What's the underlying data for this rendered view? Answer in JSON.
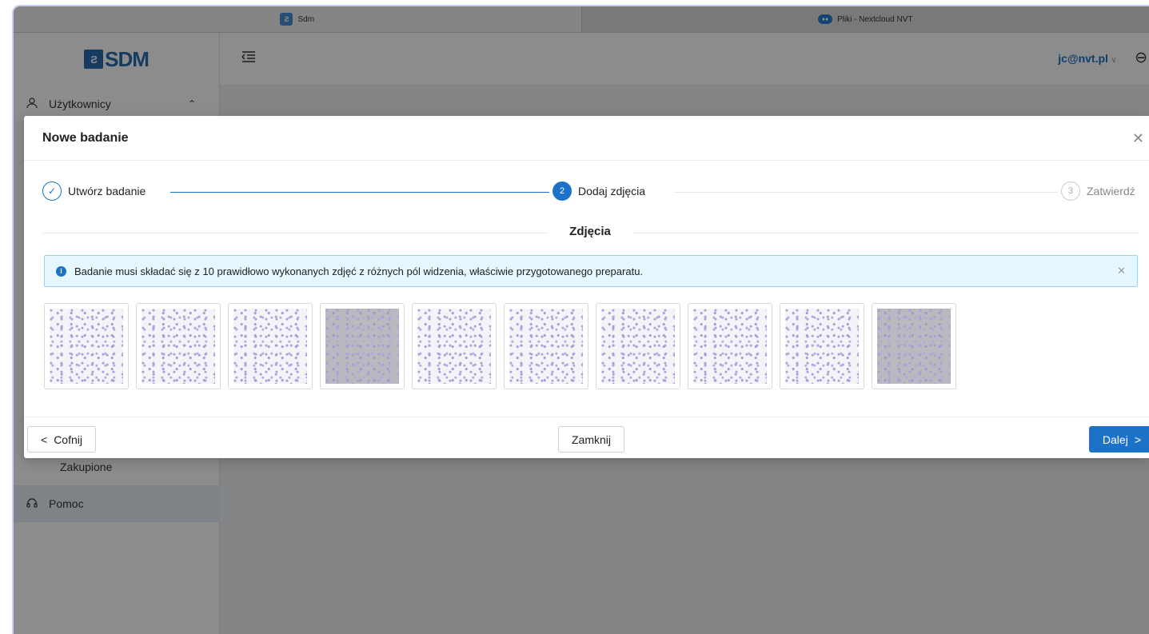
{
  "browser": {
    "tabs": [
      {
        "label": "Sdm",
        "favicon": "sdm-favicon",
        "active": true
      },
      {
        "label": "Pliki - Nextcloud NVT",
        "favicon": "nextcloud-favicon",
        "active": false
      }
    ]
  },
  "app": {
    "logo_text": "SDM",
    "user_email": "jc@nvt.pl",
    "colors": {
      "accent": "#1c72c6",
      "alert_bg": "#e6f7ff"
    }
  },
  "sidebar": {
    "items": [
      {
        "label": "Użytkownicy",
        "icon": "users-icon"
      },
      {
        "label": "Zakupione",
        "icon": ""
      },
      {
        "label": "Pomoc",
        "icon": "headset-icon"
      }
    ]
  },
  "modal": {
    "title": "Nowe badanie",
    "steps": [
      {
        "label": "Utwórz badanie",
        "state": "done",
        "number": ""
      },
      {
        "label": "Dodaj zdjęcia",
        "state": "active",
        "number": "2"
      },
      {
        "label": "Zatwierdź",
        "state": "wait",
        "number": "3"
      }
    ],
    "section_title": "Zdjęcia",
    "alert_text": "Badanie musi składać się z 10 prawidłowo wykonanych zdjęć z różnych pól widzenia, właściwie przygotowanego preparatu.",
    "images": [
      {
        "name": "image-1",
        "tone": "light"
      },
      {
        "name": "image-2",
        "tone": "light"
      },
      {
        "name": "image-3",
        "tone": "light"
      },
      {
        "name": "image-4",
        "tone": "dark"
      },
      {
        "name": "image-5",
        "tone": "light"
      },
      {
        "name": "image-6",
        "tone": "light"
      },
      {
        "name": "image-7",
        "tone": "light"
      },
      {
        "name": "image-8",
        "tone": "light"
      },
      {
        "name": "image-9",
        "tone": "light"
      },
      {
        "name": "image-10",
        "tone": "dark"
      }
    ],
    "footer": {
      "back_label": "Cofnij",
      "close_label": "Zamknij",
      "next_label": "Dalej"
    }
  }
}
